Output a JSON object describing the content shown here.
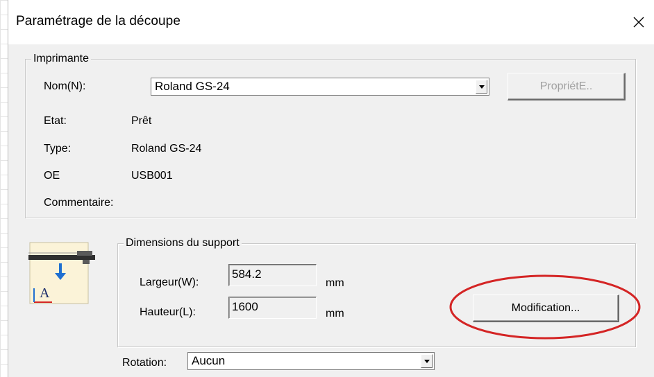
{
  "window": {
    "title": "Paramétrage de la découpe"
  },
  "printer_group": {
    "label": "Imprimante",
    "name_label": "Nom(N):",
    "name_value": "Roland GS-24",
    "properties_button": "PropriétE..",
    "status_label": "Etat:",
    "status_value": "Prêt",
    "type_label": "Type:",
    "type_value": "Roland GS-24",
    "port_label": "OE",
    "port_value": "USB001",
    "comment_label": "Commentaire:",
    "comment_value": ""
  },
  "media_group": {
    "label": "Dimensions du support",
    "width_label": "Largeur(W):",
    "width_value": "584.2",
    "width_unit": "mm",
    "height_label": "Hauteur(L):",
    "height_value": "1600",
    "height_unit": "mm",
    "modify_button": "Modification..."
  },
  "rotation": {
    "label": "Rotation:",
    "value": "Aucun"
  },
  "icons": {
    "close": "close-icon",
    "media_setup": "cutter-media-icon",
    "dropdown": "chevron-down-icon"
  },
  "colors": {
    "annotation": "#d42525",
    "media_arrow": "#1f6fd1",
    "dialog_bg": "#f0f0f0"
  }
}
